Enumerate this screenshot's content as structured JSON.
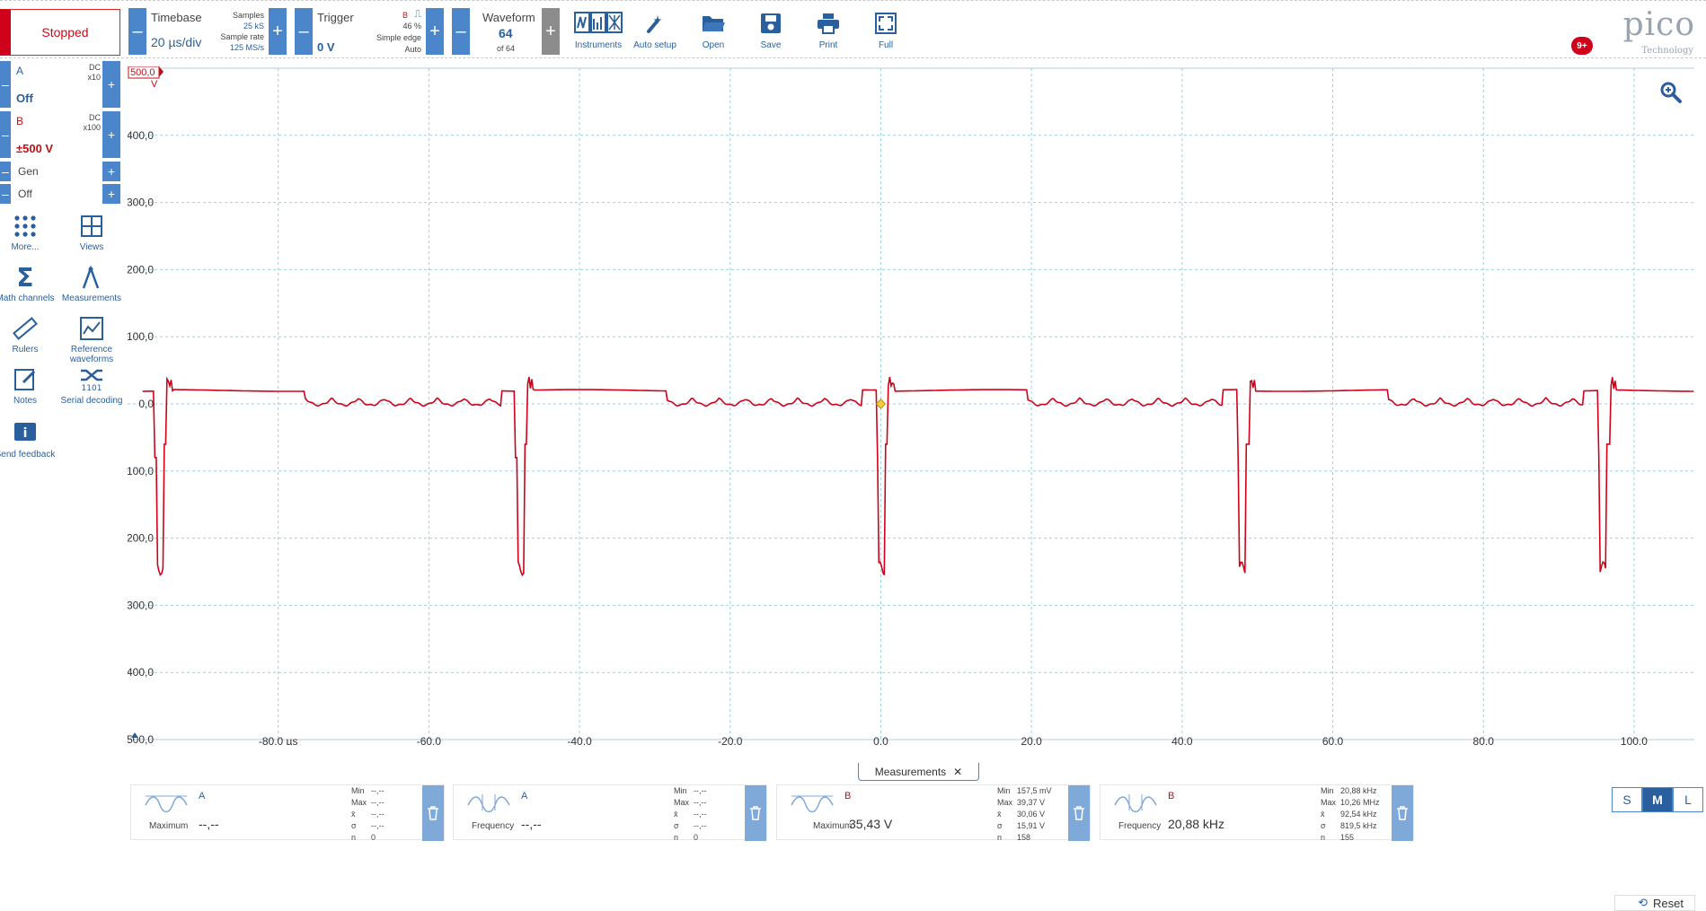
{
  "toolbar": {
    "status": "Stopped",
    "timebase": {
      "label": "Timebase",
      "value": "20 µs/div",
      "samples_label": "Samples",
      "samples_value": "25 kS",
      "rate_label": "Sample rate",
      "rate_value": "125 MS/s"
    },
    "trigger": {
      "label": "Trigger",
      "value": "0 V",
      "channel": "B",
      "percent": "46 %",
      "type": "Simple edge",
      "mode": "Auto"
    },
    "waveform": {
      "label": "Waveform",
      "value": "64",
      "of": "of 64"
    },
    "buttons": [
      {
        "label": "Instruments",
        "icon": "instruments-icon"
      },
      {
        "label": "Auto setup",
        "icon": "auto-setup-icon"
      },
      {
        "label": "Open",
        "icon": "folder-open-icon"
      },
      {
        "label": "Save",
        "icon": "save-icon"
      },
      {
        "label": "Print",
        "icon": "print-icon"
      },
      {
        "label": "Full",
        "icon": "fullscreen-icon"
      }
    ],
    "logo_word": "pico",
    "logo_sub": "Technology",
    "badge": "9+"
  },
  "sidebar": {
    "channels": [
      {
        "name": "A",
        "coupling": "DC",
        "probe": "x10",
        "range": "Off",
        "color": "#2a5f9e"
      },
      {
        "name": "B",
        "coupling": "DC",
        "probe": "x100",
        "range": "±500 V",
        "color": "#c0101a"
      }
    ],
    "gen": {
      "label": "Gen",
      "value": "Off"
    },
    "buttons": [
      {
        "label": "More...",
        "icon": "more-dots-icon"
      },
      {
        "label": "Views",
        "icon": "views-grid-icon"
      },
      {
        "label": "Math channels",
        "icon": "sigma-icon"
      },
      {
        "label": "Measurements",
        "icon": "measurements-icon"
      },
      {
        "label": "Rulers",
        "icon": "ruler-icon"
      },
      {
        "label": "Reference waveforms",
        "icon": "reference-waveforms-icon"
      },
      {
        "label": "Notes",
        "icon": "notes-icon"
      },
      {
        "label": "Serial decoding",
        "icon": "serial-decoding-icon"
      },
      {
        "label": "Send feedback",
        "icon": "info-icon"
      }
    ]
  },
  "chart_data": {
    "type": "line",
    "xlabel": "",
    "ylabel": "V",
    "xlim": [
      -100,
      108
    ],
    "ylim": [
      -500,
      500
    ],
    "x_ticks": [
      "-80,0 µs",
      "-60,0",
      "-40,0",
      "-20,0",
      "0,0",
      "20,0",
      "40,0",
      "60,0",
      "80,0",
      "100,0"
    ],
    "x_tick_values": [
      -80,
      -60,
      -40,
      -20,
      0,
      20,
      40,
      60,
      80,
      100
    ],
    "y_ticks": [
      "500,0",
      "400,0",
      "300,0",
      "200,0",
      "100,0",
      "0,0",
      "-100,0",
      "-200,0",
      "-300,0",
      "-400,0",
      "-500,0"
    ],
    "y_tick_values": [
      500,
      400,
      300,
      200,
      100,
      0,
      -100,
      -200,
      -300,
      -400,
      -500
    ],
    "grid": true,
    "series": [
      {
        "name": "B",
        "color": "#d0021b",
        "period_us": 47.9,
        "first_spike_us": -48.5,
        "high": 20,
        "low": 0,
        "spike_min": -245,
        "spike_max": 35,
        "ripple_amplitude": 10
      }
    ]
  },
  "measurements": {
    "tab_label": "Measurements",
    "cards": [
      {
        "channel": "A",
        "name": "Maximum",
        "value": "--,--",
        "min": "--,--",
        "max": "--,--",
        "mean": "--,--",
        "sigma": "--,--",
        "n": "0",
        "color": "#2a5f9e"
      },
      {
        "channel": "A",
        "name": "Frequency",
        "value": "--,--",
        "min": "--,--",
        "max": "--,--",
        "mean": "--,--",
        "sigma": "--,--",
        "n": "0",
        "color": "#2a5f9e"
      },
      {
        "channel": "B",
        "name": "Maximum",
        "value": "35,43 V",
        "min": "157,5 mV",
        "max": "39,37 V",
        "mean": "30,06 V",
        "sigma": "15,91 V",
        "n": "158",
        "color": "#c0101a"
      },
      {
        "channel": "B",
        "name": "Frequency",
        "value": "20,88 kHz",
        "min": "20,88 kHz",
        "max": "10,26 MHz",
        "mean": "92,54 kHz",
        "sigma": "819,5 kHz",
        "n": "155",
        "color": "#c0101a"
      }
    ],
    "stat_labels": {
      "min": "Min",
      "max": "Max",
      "mean": "x̄",
      "sigma": "σ",
      "n": "n"
    },
    "size_buttons": [
      "S",
      "M",
      "L"
    ],
    "size_selected": "M",
    "reset_label": "Reset"
  }
}
